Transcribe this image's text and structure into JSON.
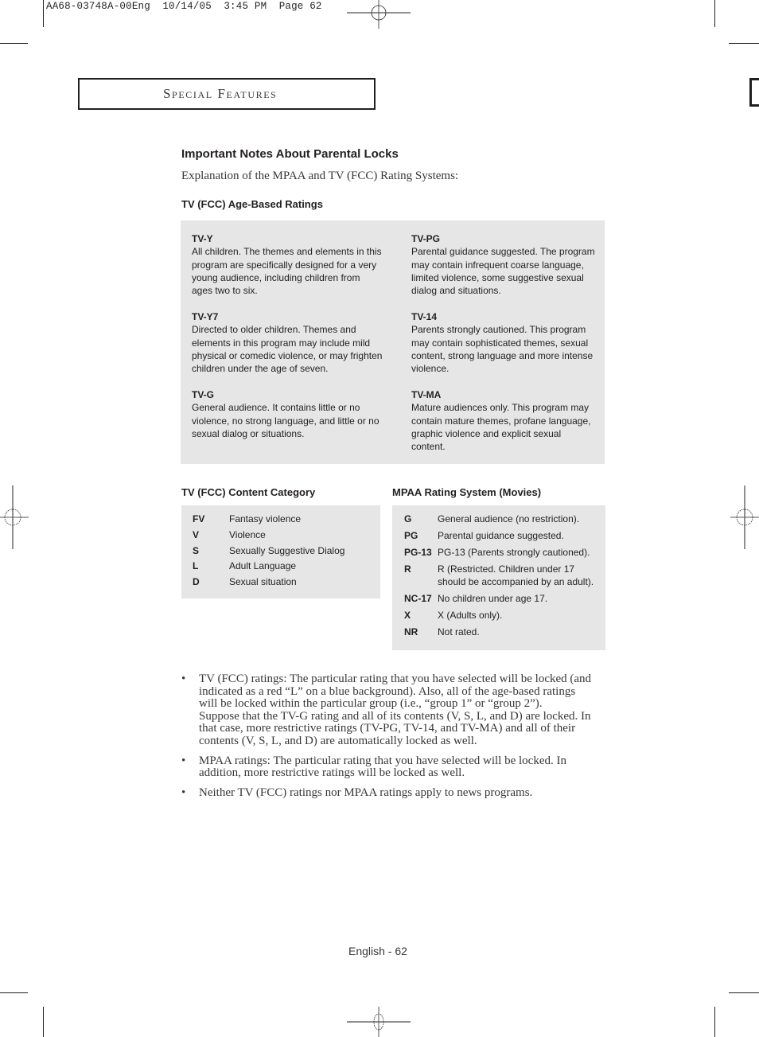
{
  "print_slug": {
    "job_id": "AA68-03748A-00Eng",
    "date": "10/14/05",
    "time": "3:45 PM",
    "page_label": "Page 62"
  },
  "section": {
    "title": "Special Features"
  },
  "page_title": "Important Notes About Parental Locks",
  "intro": "Explanation of the MPAA and TV (FCC) Rating Systems:",
  "age_ratings": {
    "heading": "TV (FCC) Age-Based Ratings",
    "left": [
      {
        "code": "TV-Y",
        "desc": "All children. The themes and elements in this program are specifically designed for a very young audience, including children from ages two to six."
      },
      {
        "code": "TV-Y7",
        "desc": "Directed to older children. Themes and elements in this program may include mild physical or comedic violence, or may frighten children under the age of seven."
      },
      {
        "code": "TV-G",
        "desc": "General audience.  It contains little or no violence, no strong language, and little or no sexual dialog or situations."
      }
    ],
    "right": [
      {
        "code": "TV-PG",
        "desc": "Parental guidance suggested. The program may contain infrequent coarse language, limited violence, some suggestive sexual dialog and situations."
      },
      {
        "code": "TV-14",
        "desc": "Parents strongly cautioned. This program may contain sophisticated themes, sexual content, strong language and more intense violence."
      },
      {
        "code": "TV-MA",
        "desc": "Mature audiences only. This program may contain mature themes, profane language, graphic violence and explicit sexual content."
      }
    ]
  },
  "content_category": {
    "heading": "TV (FCC) Content Category",
    "items": [
      {
        "code": "FV",
        "desc": "Fantasy violence"
      },
      {
        "code": "V",
        "desc": "Violence"
      },
      {
        "code": "S",
        "desc": "Sexually Suggestive Dialog"
      },
      {
        "code": "L",
        "desc": "Adult Language"
      },
      {
        "code": "D",
        "desc": "Sexual situation"
      }
    ]
  },
  "mpaa": {
    "heading": "MPAA Rating System (Movies)",
    "items": [
      {
        "code": "G",
        "desc": "General audience (no restriction)."
      },
      {
        "code": "PG",
        "desc": "Parental guidance suggested."
      },
      {
        "code": "PG-13",
        "desc": "PG-13 (Parents strongly cautioned)."
      },
      {
        "code": "R",
        "desc": "R (Restricted. Children under 17 should be accompanied by an adult)."
      },
      {
        "code": "NC-17",
        "desc": "No children under age 17."
      },
      {
        "code": "X",
        "desc": "X (Adults only)."
      },
      {
        "code": "NR",
        "desc": "Not rated."
      }
    ]
  },
  "notes": [
    {
      "bullet": "•",
      "paragraphs": [
        "TV (FCC) ratings: The particular rating that you have selected will be locked (and indicated as a red “L” on a blue background). Also, all of the age-based ratings will be locked within the particular group (i.e., “group 1” or “group 2”).",
        "Suppose that the TV-G rating and all of its contents (V, S, L, and D) are locked. In that case, more restrictive ratings (TV-PG, TV-14, and TV-MA) and all of their contents (V, S, L, and D) are automatically locked as well."
      ]
    },
    {
      "bullet": "•",
      "paragraphs": [
        "MPAA ratings: The particular rating that you have selected will be locked. In addition, more restrictive ratings will be locked as well."
      ]
    },
    {
      "bullet": "•",
      "paragraphs": [
        "Neither TV (FCC) ratings nor MPAA ratings apply to news programs."
      ]
    }
  ],
  "footer": {
    "page_number": "English - 62"
  }
}
